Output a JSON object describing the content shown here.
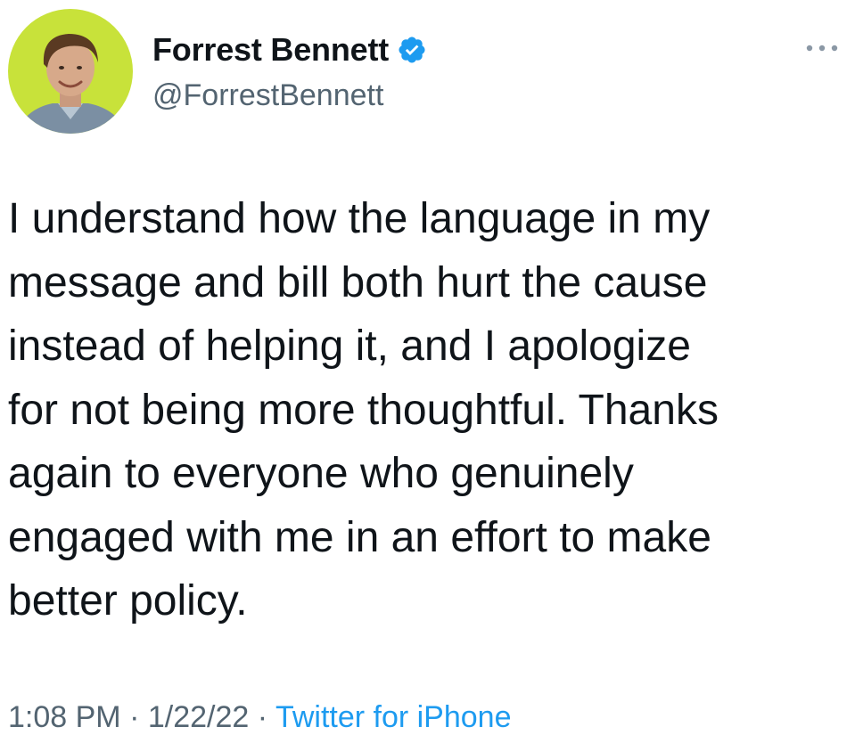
{
  "author": {
    "display_name": "Forrest Bennett",
    "handle": "@ForrestBennett",
    "verified": true,
    "avatar_icon": "profile-photo",
    "avatar_bg_color": "#c8e23a"
  },
  "tweet": {
    "text": "I understand how the language in my\nmessage and bill both hurt the cause\ninstead of helping it, and I apologize\nfor not being more thoughtful. Thanks\nagain to everyone who genuinely\nengaged with me in an effort to make\nbetter policy.",
    "time": "1:08 PM",
    "date": "1/22/22",
    "separator": "·",
    "source": "Twitter for iPhone"
  },
  "icons": {
    "verified": "verified-badge-icon",
    "more": "more-options-icon"
  },
  "colors": {
    "text_primary": "#0f1419",
    "text_secondary": "#536471",
    "accent": "#1d9bf0"
  }
}
